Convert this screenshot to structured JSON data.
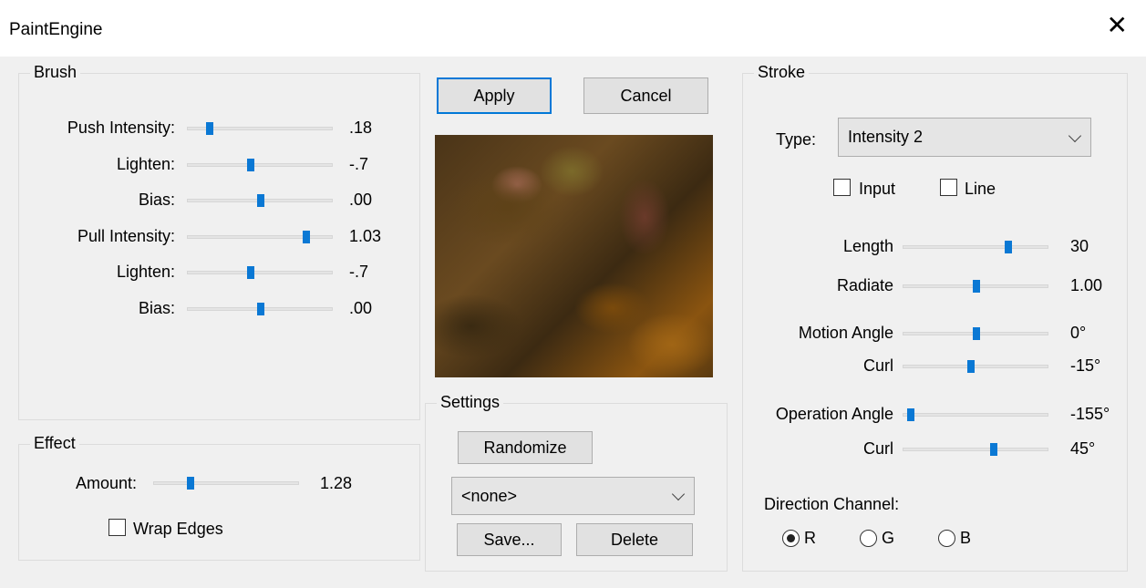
{
  "window": {
    "title": "PaintEngine"
  },
  "brush": {
    "label": "Brush",
    "rows": [
      {
        "label": "Push Intensity:",
        "value": ".18",
        "pos": 0.15
      },
      {
        "label": "Lighten:",
        "value": "-.7",
        "pos": 0.43
      },
      {
        "label": "Bias:",
        "value": ".00",
        "pos": 0.5
      },
      {
        "label": "Pull Intensity:",
        "value": "1.03",
        "pos": 0.81
      },
      {
        "label": "Lighten:",
        "value": "-.7",
        "pos": 0.43
      },
      {
        "label": "Bias:",
        "value": ".00",
        "pos": 0.5
      }
    ]
  },
  "effect": {
    "label": "Effect",
    "amount_label": "Amount:",
    "amount_value": "1.28",
    "amount_pos": 0.25,
    "wrap_label": "Wrap Edges",
    "wrap_checked": false
  },
  "buttons": {
    "apply": "Apply",
    "cancel": "Cancel"
  },
  "settings": {
    "label": "Settings",
    "randomize": "Randomize",
    "preset": "<none>",
    "save": "Save...",
    "delete": "Delete"
  },
  "stroke": {
    "label": "Stroke",
    "type_label": "Type:",
    "type_value": "Intensity 2",
    "input_label": "Input",
    "input_checked": false,
    "line_label": "Line",
    "line_checked": false,
    "rows": [
      {
        "label": "Length",
        "value": "30",
        "pos": 0.72
      },
      {
        "label": "Radiate",
        "value": "1.00",
        "pos": 0.5
      },
      {
        "label": "Motion Angle",
        "value": "0°",
        "pos": 0.5
      },
      {
        "label": "Curl",
        "value": "-15°",
        "pos": 0.46
      },
      {
        "label": "Operation Angle",
        "value": "-155°",
        "pos": 0.05
      },
      {
        "label": "Curl",
        "value": "45°",
        "pos": 0.62
      }
    ],
    "direction_label": "Direction Channel:",
    "channels": [
      "R",
      "G",
      "B"
    ],
    "selected_channel": "R"
  },
  "colors": {
    "accent": "#0078d7",
    "thumb": "#0a78d4"
  }
}
